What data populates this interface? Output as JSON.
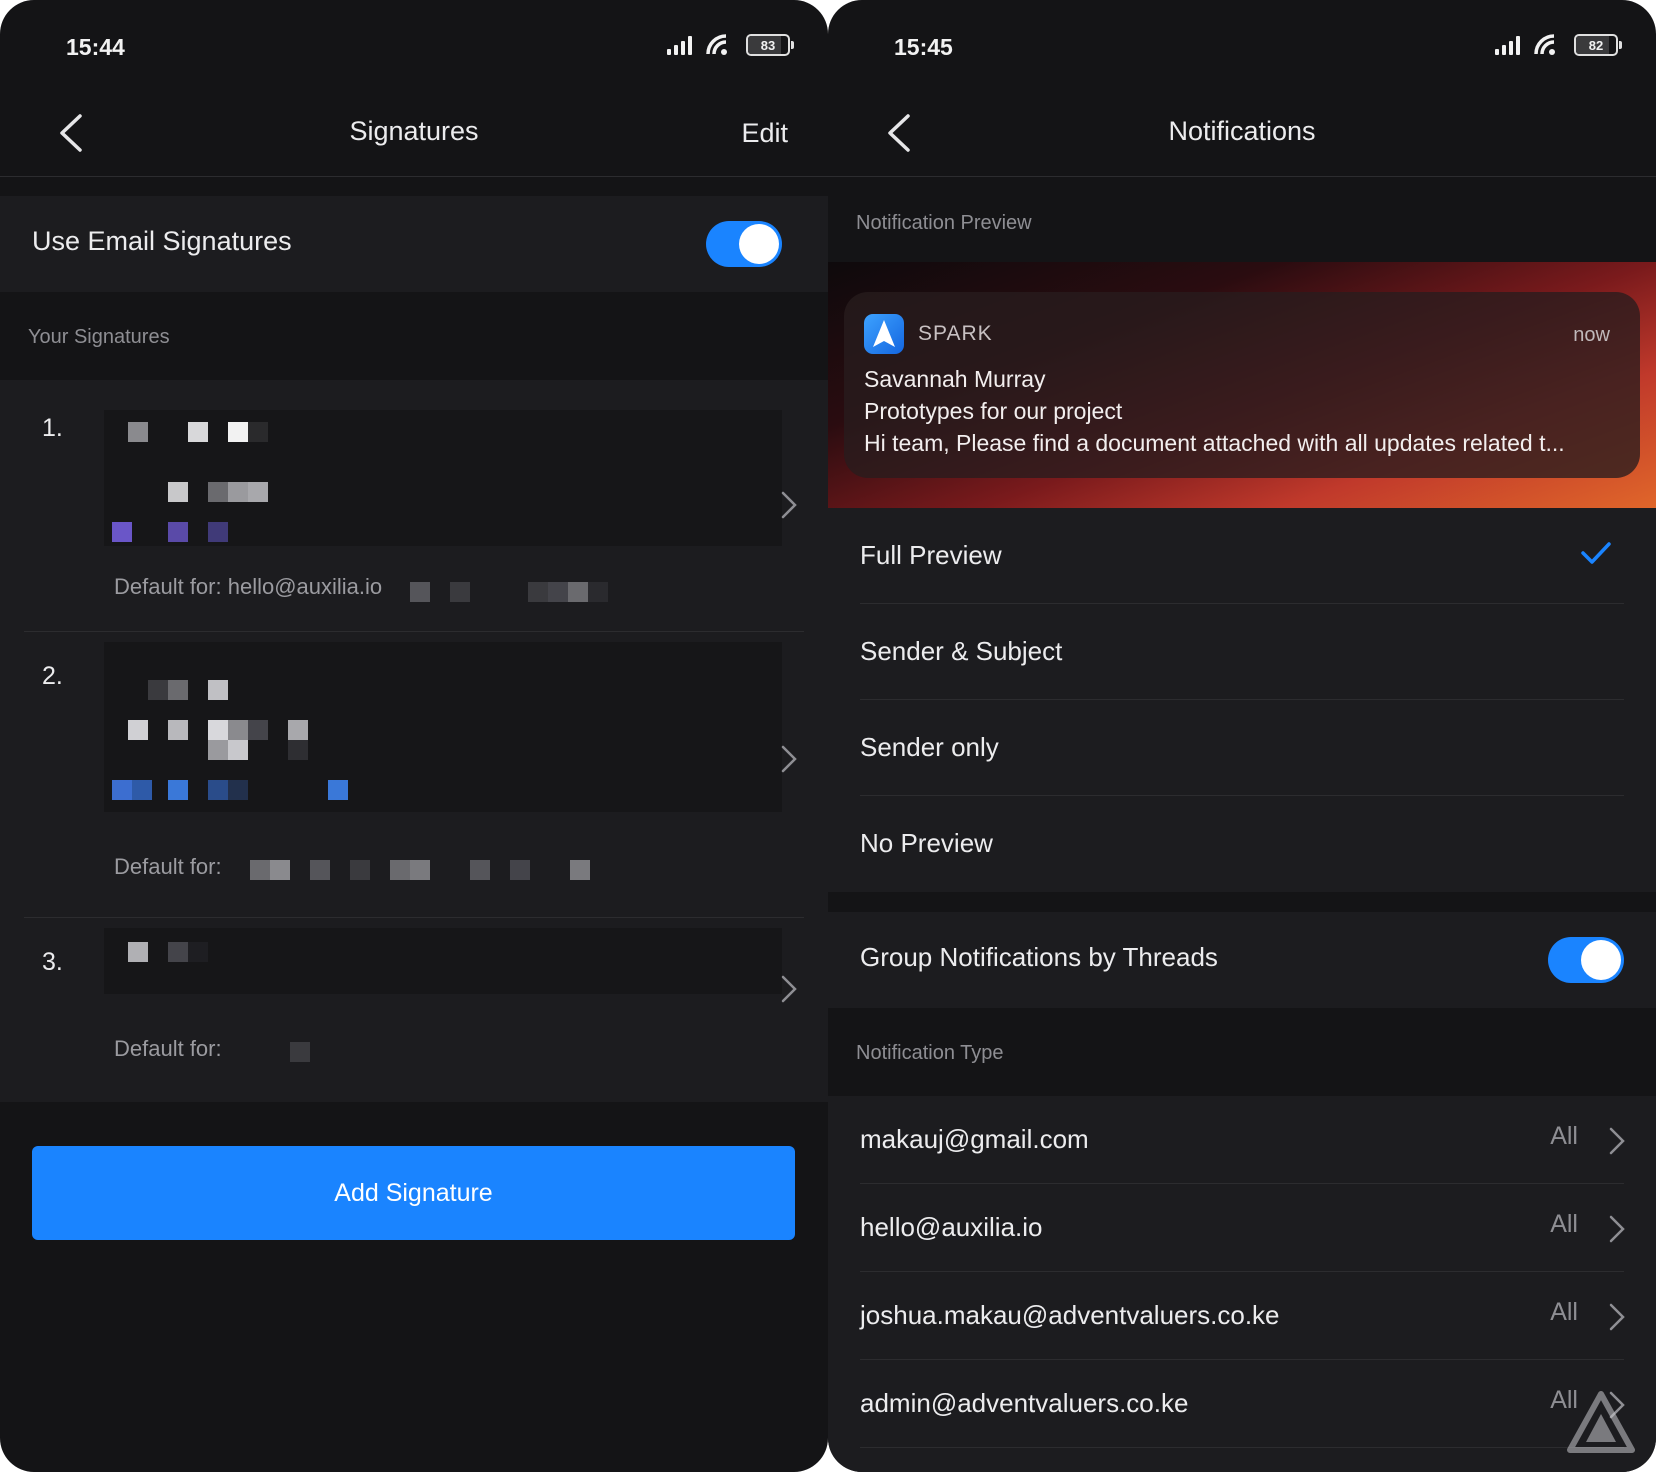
{
  "left": {
    "status": {
      "time": "15:44",
      "battery": "83",
      "battery_level_percent": 83
    },
    "nav": {
      "title": "Signatures",
      "action": "Edit"
    },
    "use_signatures": {
      "label": "Use Email Signatures",
      "enabled": true
    },
    "section_label": "Your Signatures",
    "signatures": [
      {
        "number": "1.",
        "default_label": "Default for: hello@auxilia.io"
      },
      {
        "number": "2.",
        "default_label": "Default for:"
      },
      {
        "number": "3.",
        "default_label": "Default for:"
      }
    ],
    "add_button": "Add Signature"
  },
  "right": {
    "status": {
      "time": "15:45",
      "battery": "82",
      "battery_level_percent": 82
    },
    "nav": {
      "title": "Notifications"
    },
    "preview_section_label": "Notification Preview",
    "preview": {
      "app_name": "SPARK",
      "time": "now",
      "sender": "Savannah Murray",
      "subject": "Prototypes for our project",
      "body": "Hi team, Please find a document attached with all updates related t..."
    },
    "options": [
      {
        "label": "Full Preview",
        "selected": true
      },
      {
        "label": "Sender & Subject",
        "selected": false
      },
      {
        "label": "Sender only",
        "selected": false
      },
      {
        "label": "No Preview",
        "selected": false
      }
    ],
    "group_threads": {
      "label": "Group Notifications by Threads",
      "enabled": true
    },
    "type_section_label": "Notification Type",
    "accounts": [
      {
        "email": "makauj@gmail.com",
        "value": "All"
      },
      {
        "email": "hello@auxilia.io",
        "value": "All"
      },
      {
        "email": "joshua.makau@adventvaluers.co.ke",
        "value": "All"
      },
      {
        "email": "admin@adventvaluers.co.ke",
        "value": "All"
      }
    ]
  },
  "colors": {
    "accent": "#1a84ff",
    "background": "#141416",
    "row_background": "#1c1c1f",
    "secondary_text": "#8e8e93"
  }
}
